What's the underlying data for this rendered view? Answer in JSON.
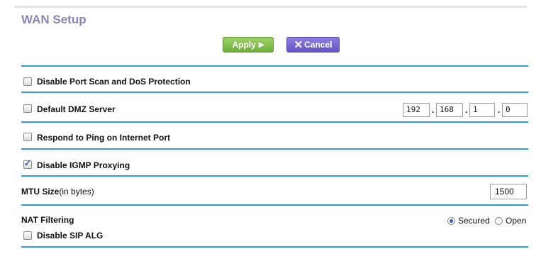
{
  "page": {
    "title": "WAN Setup"
  },
  "toolbar": {
    "apply_label": "Apply",
    "apply_icon": "play-arrow-icon",
    "cancel_label": "Cancel",
    "cancel_icon": "x-icon"
  },
  "settings": {
    "disable_port_scan": {
      "label": "Disable Port Scan and DoS Protection",
      "checked": false
    },
    "default_dmz": {
      "label": "Default DMZ Server",
      "checked": false,
      "ip": [
        "192",
        "168",
        "1",
        "0"
      ],
      "separator": "."
    },
    "respond_ping": {
      "label": "Respond to Ping on Internet Port",
      "checked": false
    },
    "disable_igmp": {
      "label": "Disable IGMP Proxying",
      "checked": true
    },
    "mtu": {
      "label_bold": "MTU Size",
      "label_suffix": "(in bytes)",
      "value": "1500"
    },
    "nat": {
      "label": "NAT Filtering",
      "options": [
        {
          "label": "Secured",
          "selected": true
        },
        {
          "label": "Open",
          "selected": false
        }
      ]
    },
    "disable_sip_alg": {
      "label": "Disable SIP ALG",
      "checked": false
    }
  },
  "colors": {
    "rule": "#2aa0d9",
    "title": "#8a84b8",
    "apply": "#6fae3a",
    "cancel": "#6553c4"
  }
}
